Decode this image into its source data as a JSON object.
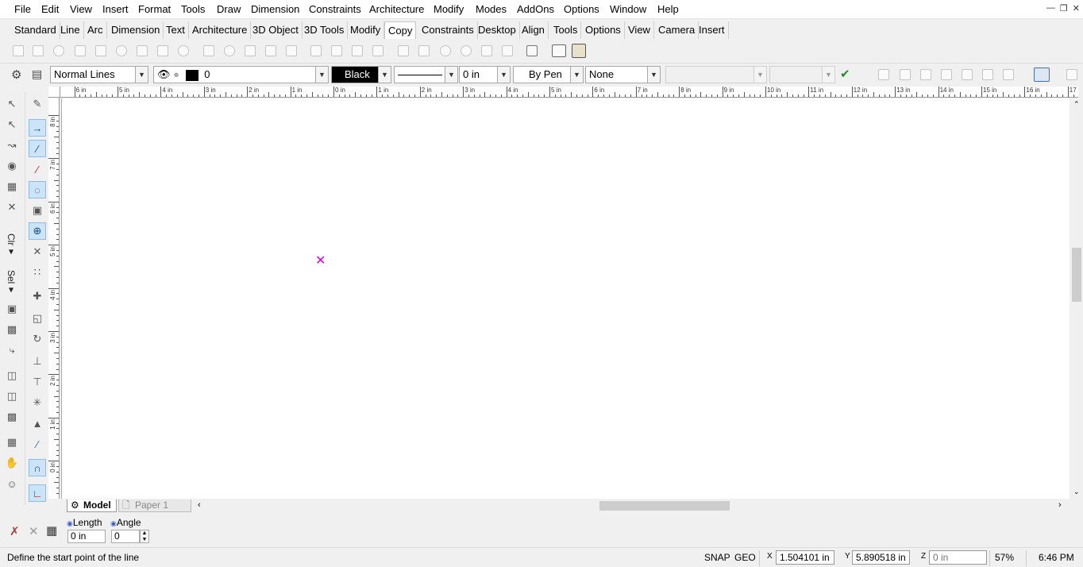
{
  "menu": [
    "File",
    "Edit",
    "View",
    "Insert",
    "Format",
    "Tools",
    "Draw",
    "Dimension",
    "Constraints",
    "Architecture",
    "Modify",
    "Modes",
    "AddOns",
    "Options",
    "Window",
    "Help"
  ],
  "window_controls": [
    "minimize-icon",
    "restore-icon",
    "close-icon"
  ],
  "toolbar_tabs": [
    "Standard",
    "Line",
    "Arc",
    "Dimension",
    "Text",
    "Architecture",
    "3D Object",
    "3D Tools",
    "Modify",
    "Copy",
    "Constraints",
    "Desktop",
    "Align",
    "Tools",
    "Options",
    "View",
    "Camera",
    "Insert"
  ],
  "active_tab": "Copy",
  "props": {
    "line_style": "Normal Lines",
    "layer": "0",
    "color_name": "Black",
    "color_hex": "#000000",
    "line_width": "0 in",
    "pen": "By Pen",
    "fill": "None"
  },
  "rulers": {
    "h_labels": [
      "6 in",
      "5 in",
      "4 in",
      "3 in",
      "2 in",
      "1 in",
      "0 in",
      "1 in",
      "2 in",
      "3 in",
      "4 in",
      "5 in",
      "6 in",
      "7 in",
      "8 in",
      "9 in",
      "10 in",
      "11 in",
      "12 in",
      "13 in",
      "14 in",
      "15 in",
      "16 in",
      "17 in"
    ],
    "v_labels": [
      "8 in",
      "7 in",
      "6 in",
      "5 in",
      "4 in",
      "3 in",
      "2 in",
      "1 in",
      "0 in"
    ]
  },
  "sheets": {
    "model": "Model",
    "paper": "Paper 1"
  },
  "input": {
    "length_label": "Length",
    "angle_label": "Angle",
    "length_value": "0 in",
    "angle_value": "0"
  },
  "status": {
    "prompt": "Define the start point of the line",
    "snap": "SNAP",
    "geo": "GEO",
    "x": "1.504101 in",
    "y": "5.890518 in",
    "z_placeholder": "0 in",
    "zoom": "57%",
    "time": "6:46 PM"
  },
  "colors": {
    "accent": "#cce4f7",
    "cursor": "#e000e0"
  }
}
